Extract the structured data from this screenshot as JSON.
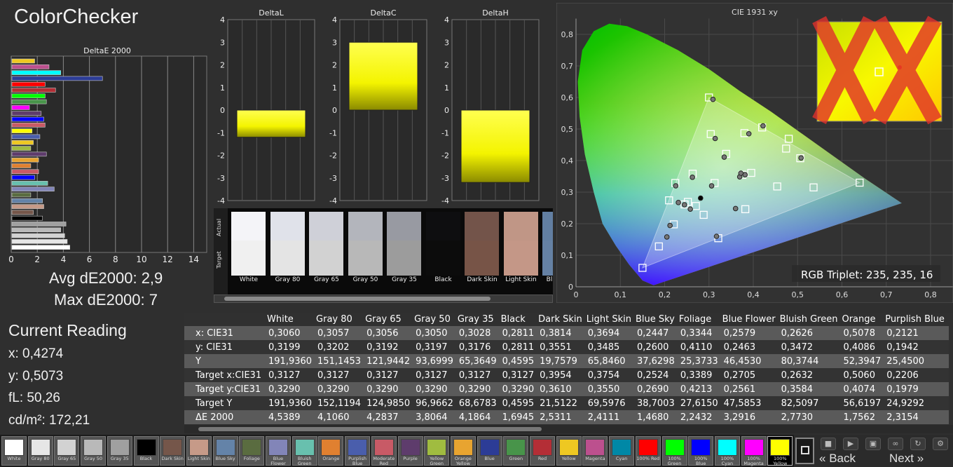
{
  "app": {
    "title": "ColorChecker"
  },
  "stats": {
    "avg": "Avg dE2000: 2,9",
    "max": "Max dE2000: 7"
  },
  "current": {
    "title": "Current Reading",
    "x": "x: 0,4274",
    "y": "y: 0,5073",
    "fl": "fL: 50,26",
    "cd": "cd/m²: 172,21"
  },
  "strip": {
    "actual_label": "Actual",
    "target_label": "Target",
    "swatches": [
      {
        "name": "White",
        "actual": "#f4f4f8",
        "target": "#f0f0f0"
      },
      {
        "name": "Gray 80",
        "actual": "#e0e2ea",
        "target": "#e4e4e4"
      },
      {
        "name": "Gray 65",
        "actual": "#cfd0d8",
        "target": "#d2d2d2"
      },
      {
        "name": "Gray 50",
        "actual": "#b3b5bc",
        "target": "#b8b8b8"
      },
      {
        "name": "Gray 35",
        "actual": "#989aa2",
        "target": "#9c9c9c"
      },
      {
        "name": "Black",
        "actual": "#0e0e10",
        "target": "#0c0c0c"
      },
      {
        "name": "Dark Skin",
        "actual": "#73544a",
        "target": "#775447"
      },
      {
        "name": "Light Skin",
        "actual": "#c09686",
        "target": "#c49787"
      },
      {
        "name": "Blue Sky",
        "actual": "#627fa2",
        "target": "#6581a4"
      }
    ]
  },
  "table": {
    "columns": [
      "",
      "White",
      "Gray 80",
      "Gray 65",
      "Gray 50",
      "Gray 35",
      "Black",
      "Dark Skin",
      "Light Skin",
      "Blue Sky",
      "Foliage",
      "Blue Flower",
      "Bluish Green",
      "Orange",
      "Purplish Blue"
    ],
    "rows": [
      {
        "label": "x: CIE31",
        "values": [
          "0,3060",
          "0,3057",
          "0,3056",
          "0,3050",
          "0,3028",
          "0,2811",
          "0,3814",
          "0,3694",
          "0,2447",
          "0,3344",
          "0,2579",
          "0,2626",
          "0,5078",
          "0,2121"
        ]
      },
      {
        "label": "y: CIE31",
        "values": [
          "0,3199",
          "0,3202",
          "0,3192",
          "0,3197",
          "0,3176",
          "0,2811",
          "0,3551",
          "0,3485",
          "0,2600",
          "0,4110",
          "0,2463",
          "0,3472",
          "0,4086",
          "0,1942"
        ]
      },
      {
        "label": "Y",
        "values": [
          "191,9360",
          "151,1453",
          "121,9442",
          "93,6999",
          "65,3649",
          "0,4595",
          "19,7579",
          "65,8460",
          "37,6298",
          "25,3733",
          "46,4530",
          "80,3744",
          "52,3947",
          "25,4500"
        ]
      },
      {
        "label": "Target x:CIE31",
        "values": [
          "0,3127",
          "0,3127",
          "0,3127",
          "0,3127",
          "0,3127",
          "0,3127",
          "0,3954",
          "0,3754",
          "0,2524",
          "0,3389",
          "0,2705",
          "0,2632",
          "0,5060",
          "0,2206"
        ]
      },
      {
        "label": "Target y:CIE31",
        "values": [
          "0,3290",
          "0,3290",
          "0,3290",
          "0,3290",
          "0,3290",
          "0,3290",
          "0,3610",
          "0,3550",
          "0,2690",
          "0,4213",
          "0,2561",
          "0,3584",
          "0,4074",
          "0,1979"
        ]
      },
      {
        "label": "Target Y",
        "values": [
          "191,9360",
          "152,1194",
          "124,9850",
          "96,9662",
          "68,6783",
          "0,4595",
          "21,5122",
          "69,5976",
          "38,7003",
          "27,6150",
          "47,5853",
          "82,5097",
          "56,6197",
          "24,9292"
        ]
      },
      {
        "label": "ΔE 2000",
        "values": [
          "4,5389",
          "4,1060",
          "4,2837",
          "3,8064",
          "4,1864",
          "1,6945",
          "2,5311",
          "2,4111",
          "1,4680",
          "2,2432",
          "3,2916",
          "2,7730",
          "1,7562",
          "2,3154"
        ]
      }
    ]
  },
  "chips": [
    {
      "label": "White",
      "color": "#ffffff"
    },
    {
      "label": "Gray 80",
      "color": "#e6e6e6"
    },
    {
      "label": "Gray 65",
      "color": "#d2d2d2"
    },
    {
      "label": "Gray 50",
      "color": "#b9b9b9"
    },
    {
      "label": "Gray 35",
      "color": "#a0a0a0"
    },
    {
      "label": "Black",
      "color": "#000000"
    },
    {
      "label": "Dark Skin",
      "color": "#75564a"
    },
    {
      "label": "Light Skin",
      "color": "#c69a88"
    },
    {
      "label": "Blue Sky",
      "color": "#6483a8"
    },
    {
      "label": "Foliage",
      "color": "#5a6c40"
    },
    {
      "label": "Blue Flower",
      "color": "#8285b8"
    },
    {
      "label": "Bluish Green",
      "color": "#68c0ae"
    },
    {
      "label": "Orange",
      "color": "#e08030"
    },
    {
      "label": "Purplish Blue",
      "color": "#4a5eac"
    },
    {
      "label": "Moderate Red",
      "color": "#c85a66"
    },
    {
      "label": "Purple",
      "color": "#5e3c6c"
    },
    {
      "label": "Yellow Green",
      "color": "#a0bc40"
    },
    {
      "label": "Orange Yellow",
      "color": "#e8a430"
    },
    {
      "label": "Blue",
      "color": "#2c3c96"
    },
    {
      "label": "Green",
      "color": "#48944a"
    },
    {
      "label": "Red",
      "color": "#b42e36"
    },
    {
      "label": "Yellow",
      "color": "#eec822"
    },
    {
      "label": "Magenta",
      "color": "#bc508e"
    },
    {
      "label": "Cyan",
      "color": "#0088a6"
    },
    {
      "label": "100% Red",
      "color": "#ff0000"
    },
    {
      "label": "100% Green",
      "color": "#00ff00"
    },
    {
      "label": "100% Blue",
      "color": "#0000ff"
    },
    {
      "label": "100% Cyan",
      "color": "#00ffff"
    },
    {
      "label": "100% Magenta",
      "color": "#ff00ff"
    },
    {
      "label": "100% Yellow",
      "color": "#ffff00"
    }
  ],
  "controls": {
    "back": "Back",
    "next": "Next",
    "back_arrow": "«",
    "next_arrow": "»"
  },
  "chart_data": [
    {
      "type": "bar",
      "title": "DeltaE 2000",
      "orientation": "horizontal",
      "xlim": [
        0,
        15
      ],
      "xticks": [
        "0",
        "2",
        "4",
        "6",
        "8",
        "10",
        "12",
        "14"
      ],
      "values": [
        1.8,
        2.9,
        3.8,
        7.0,
        2.6,
        3.4,
        2.6,
        2.7,
        1.4,
        2.3,
        2.5,
        2.6,
        1.6,
        2.2,
        1.7,
        1.5,
        2.7,
        2.1,
        1.5,
        2.1,
        1.8,
        2.8,
        3.3,
        1.5,
        2.4,
        2.5,
        1.7,
        2.4,
        4.2,
        3.8,
        4.1,
        4.3,
        4.5
      ],
      "colors": [
        "#eec822",
        "#bc508e",
        "#00ffff",
        "#2c3c96",
        "#ff0000",
        "#b42e36",
        "#00ff00",
        "#48944a",
        "#ff00ff",
        "#5e3c6c",
        "#0000ff",
        "#c85a66",
        "#ffff00",
        "#4a5eac",
        "#eec822",
        "#a0bc40",
        "#5e3c6c",
        "#e8a430",
        "#e08030",
        "#c85a66",
        "#0000ff",
        "#68c0ae",
        "#8285b8",
        "#5a6c40",
        "#6483a8",
        "#c69a88",
        "#75564a",
        "#000000",
        "#a0a0a0",
        "#b9b9b9",
        "#d2d2d2",
        "#e6e6e6",
        "#ffffff"
      ]
    },
    {
      "type": "bar",
      "title": "DeltaL",
      "ylim": [
        -4,
        4
      ],
      "yticks": [
        "4",
        "3",
        "2",
        "1",
        "0",
        "-1",
        "-2",
        "-3",
        "-4"
      ],
      "values": [
        -1.2
      ],
      "color": "#ffff00"
    },
    {
      "type": "bar",
      "title": "DeltaC",
      "ylim": [
        -4,
        4
      ],
      "yticks": [
        "4",
        "3",
        "2",
        "1",
        "0",
        "-1",
        "-2",
        "-3",
        "-4"
      ],
      "values": [
        3.0
      ],
      "color": "#ffff00"
    },
    {
      "type": "bar",
      "title": "DeltaH",
      "ylim": [
        -4,
        4
      ],
      "yticks": [
        "4",
        "3",
        "2",
        "1",
        "0",
        "-1",
        "-2",
        "-3",
        "-4"
      ],
      "values": [
        -3.2
      ],
      "color": "#ffff00"
    },
    {
      "type": "scatter",
      "title": "CIE 1931 xy",
      "xlim": [
        0,
        0.85
      ],
      "ylim": [
        0,
        0.85
      ],
      "xticks": [
        "0",
        "0,1",
        "0,2",
        "0,3",
        "0,4",
        "0,5",
        "0,6",
        "0,7",
        "0,8"
      ],
      "yticks": [
        "0,8",
        "0,7",
        "0,6",
        "0,5",
        "0,4",
        "0,3",
        "0,2",
        "0,1",
        "0"
      ],
      "gamut": [
        [
          0.15,
          0.06
        ],
        [
          0.64,
          0.33
        ],
        [
          0.3,
          0.6
        ]
      ],
      "targets": [
        [
          0.15,
          0.06
        ],
        [
          0.64,
          0.33
        ],
        [
          0.3,
          0.6
        ],
        [
          0.3127,
          0.329
        ],
        [
          0.3954,
          0.361
        ],
        [
          0.3754,
          0.355
        ],
        [
          0.2524,
          0.269
        ],
        [
          0.3389,
          0.4213
        ],
        [
          0.2705,
          0.2561
        ],
        [
          0.2632,
          0.3584
        ],
        [
          0.506,
          0.4074
        ],
        [
          0.2206,
          0.1979
        ],
        [
          0.454,
          0.318
        ],
        [
          0.288,
          0.228
        ],
        [
          0.38,
          0.487
        ],
        [
          0.474,
          0.438
        ],
        [
          0.187,
          0.128
        ],
        [
          0.304,
          0.484
        ],
        [
          0.536,
          0.315
        ],
        [
          0.48,
          0.469
        ],
        [
          0.382,
          0.246
        ],
        [
          0.21,
          0.274
        ],
        [
          0.321,
          0.154
        ],
        [
          0.224,
          0.329
        ],
        [
          0.42,
          0.505
        ],
        [
          0.245,
          0.261
        ]
      ],
      "measured": [
        [
          0.306,
          0.3199
        ],
        [
          0.3814,
          0.3551
        ],
        [
          0.3694,
          0.3485
        ],
        [
          0.2447,
          0.26
        ],
        [
          0.3344,
          0.411
        ],
        [
          0.2579,
          0.2463
        ],
        [
          0.2626,
          0.3472
        ],
        [
          0.5078,
          0.4086
        ],
        [
          0.2121,
          0.1942
        ],
        [
          0.2811,
          0.2811
        ],
        [
          0.309,
          0.594
        ],
        [
          0.314,
          0.47
        ],
        [
          0.205,
          0.158
        ],
        [
          0.231,
          0.267
        ],
        [
          0.36,
          0.248
        ],
        [
          0.39,
          0.485
        ],
        [
          0.317,
          0.16
        ],
        [
          0.225,
          0.32
        ],
        [
          0.422,
          0.51
        ],
        [
          0.372,
          0.36
        ]
      ],
      "inset": {
        "gamut": "100% Yellow"
      },
      "readout": "RGB Triplet: 235, 235, 16"
    }
  ]
}
